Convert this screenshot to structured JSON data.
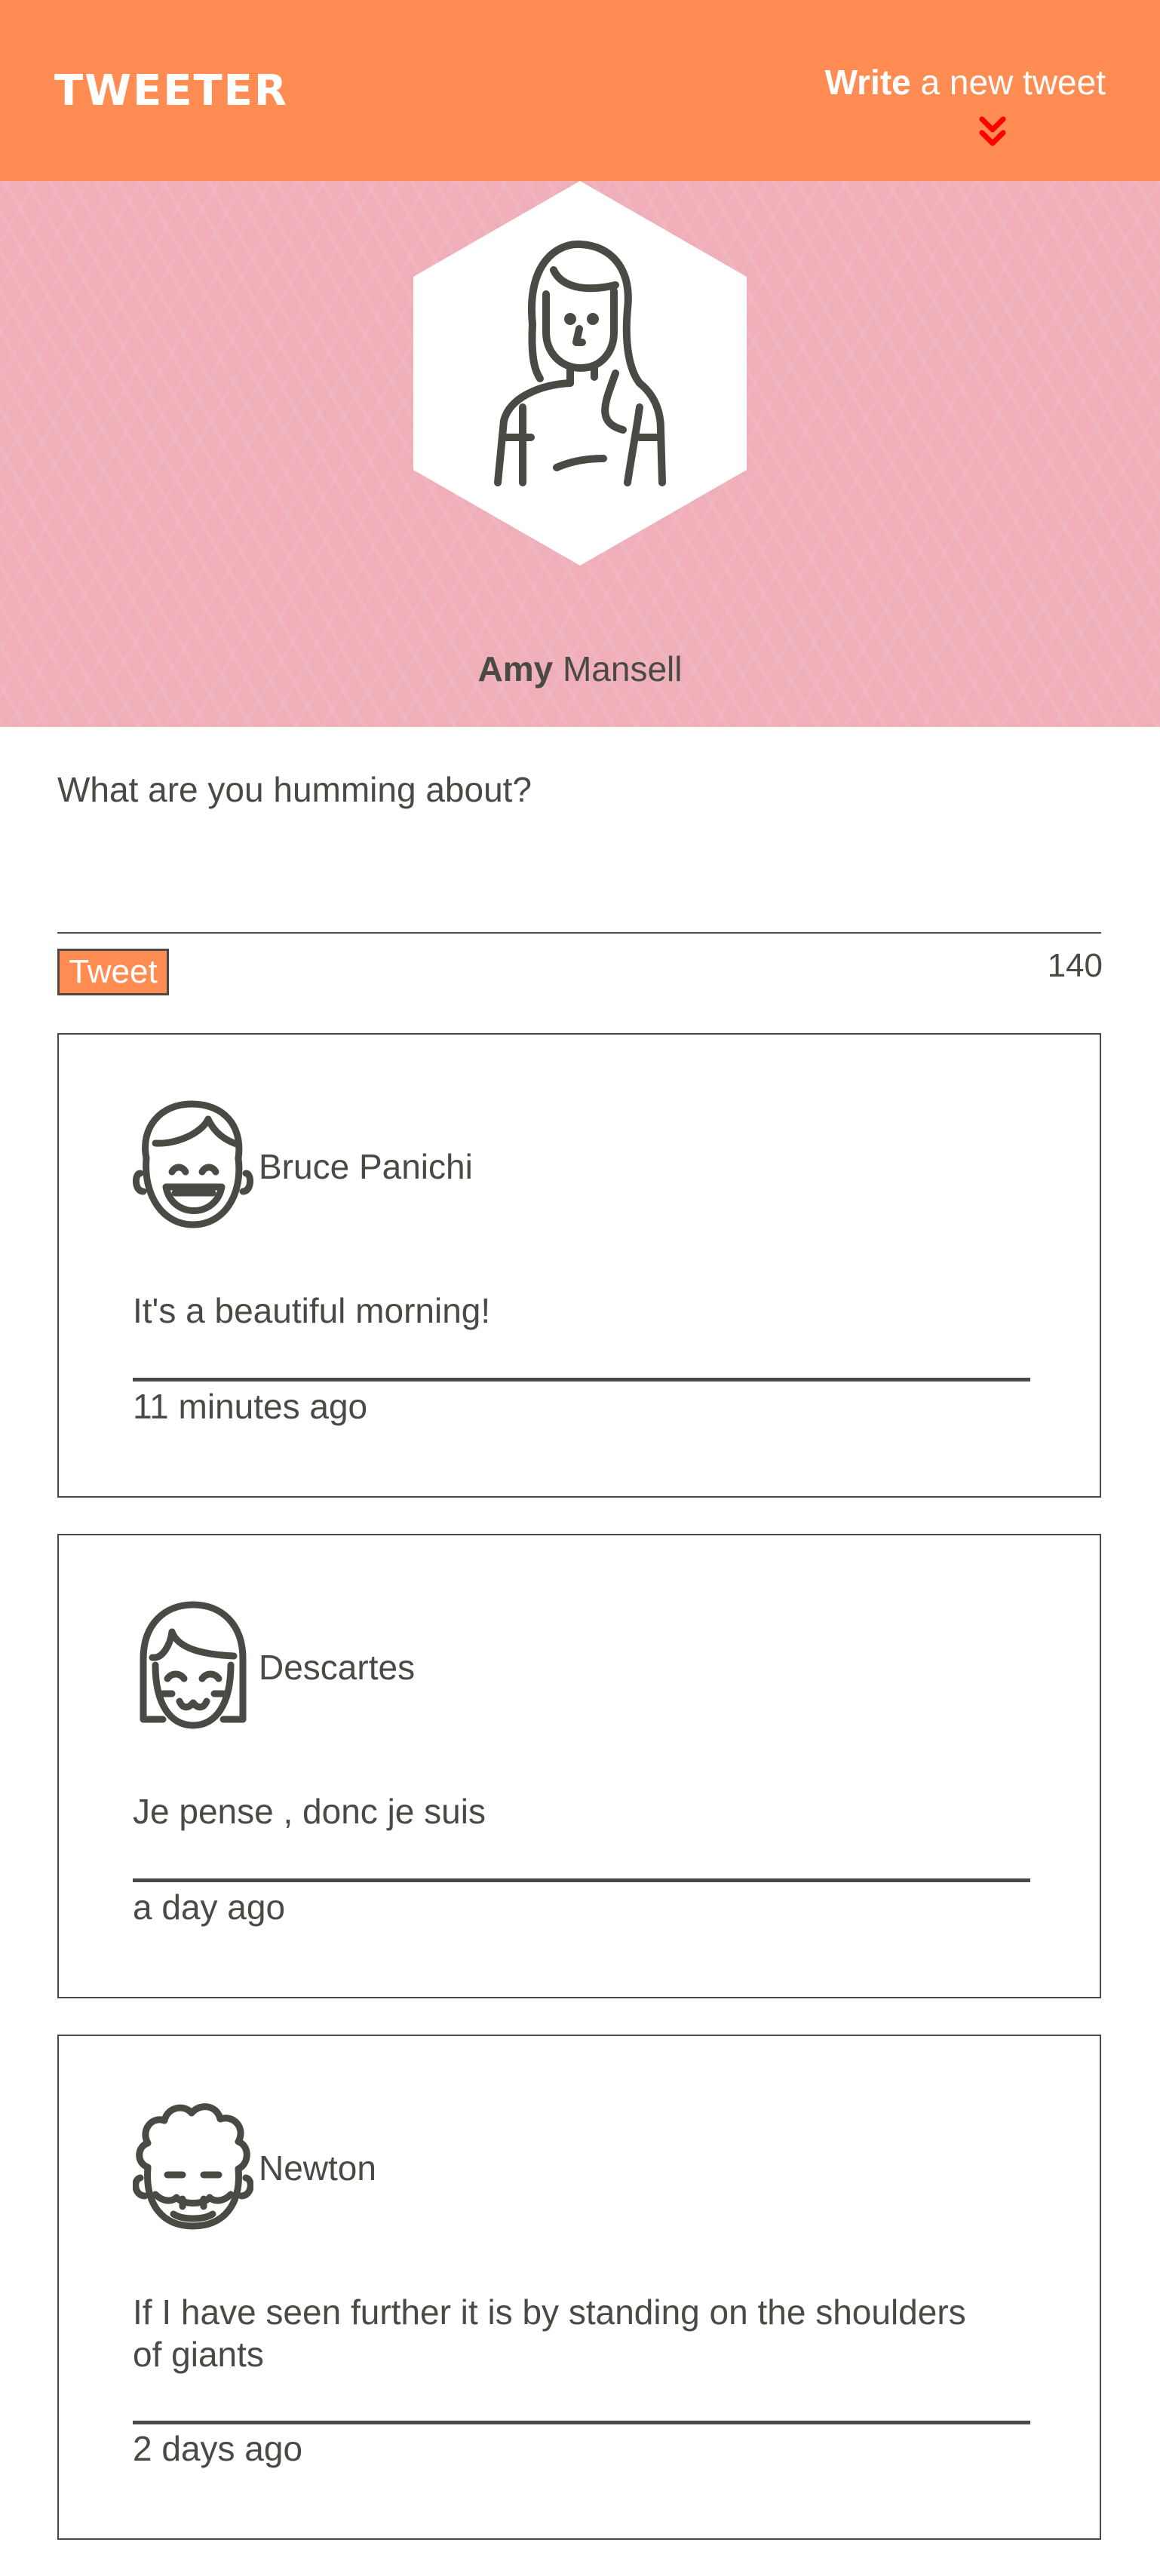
{
  "header": {
    "logo": "TWEETER",
    "compose_bold": "Write",
    "compose_rest": " a new tweet",
    "chevron_icon": "double-chevron-down-icon",
    "chevron_color": "#ff0000",
    "background": "#ff8c53"
  },
  "profile": {
    "first_name": "Amy",
    "last_name": " Mansell",
    "avatar_icon": "woman-avatar-icon",
    "banner_color": "#efaeb8"
  },
  "composer": {
    "placeholder": "What are you humming about?",
    "value": "",
    "button_label": "Tweet",
    "counter": "140"
  },
  "tweets": [
    {
      "author": "Bruce Panichi",
      "avatar_icon": "smiling-man-avatar-icon",
      "text": "It's a beautiful morning!",
      "time": "11 minutes ago"
    },
    {
      "author": "Descartes",
      "avatar_icon": "bob-haircut-avatar-icon",
      "text": "Je pense , donc je suis",
      "time": "a day ago"
    },
    {
      "author": "Newton",
      "avatar_icon": "curly-hair-avatar-icon",
      "text": "If I have seen further it is by standing on the shoulders of giants",
      "time": "2 days ago"
    }
  ],
  "colors": {
    "accent": "#ff8c53",
    "text": "#4a4944",
    "banner": "#efaeb8"
  }
}
